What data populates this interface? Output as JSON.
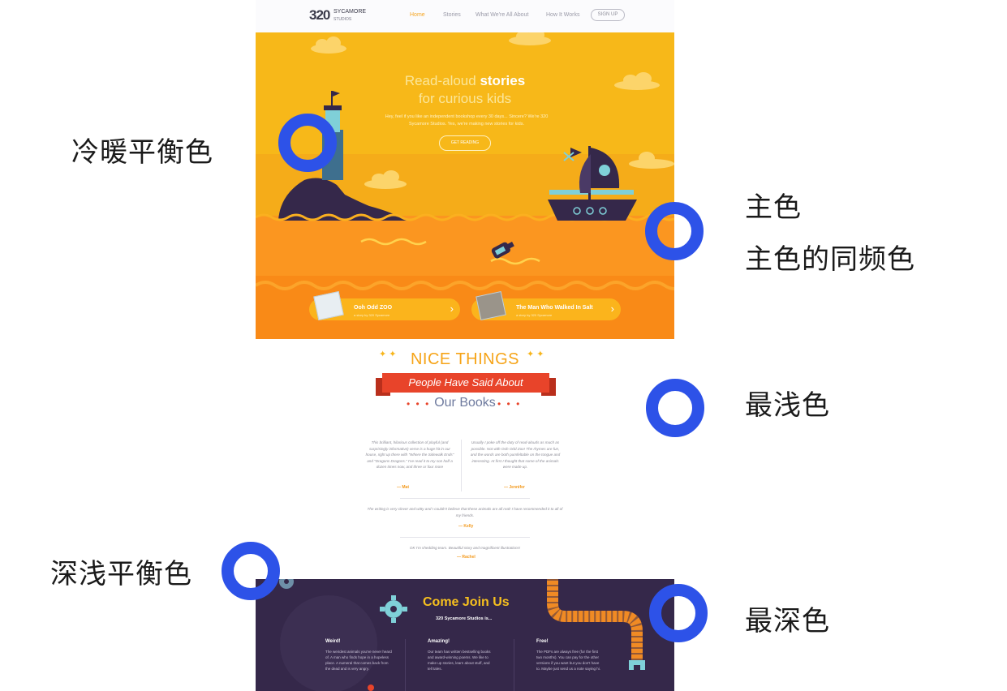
{
  "annotations": {
    "cool_warm_balance": "冷暖平衡色",
    "main_color": "主色",
    "main_color_same_frequency": "主色的同频色",
    "lightest_color": "最浅色",
    "dark_light_balance": "深浅平衡色",
    "darkest_color": "最深色"
  },
  "site": {
    "logo": {
      "number": "320",
      "name": "SYCAMORE",
      "sub": "STUDIOS"
    },
    "nav": {
      "links": [
        "Home",
        "Stories",
        "What We're All About",
        "How It Works"
      ],
      "active": "Home",
      "signup": "SIGN UP"
    },
    "hero": {
      "title_part1": "Read-aloud ",
      "title_bold": "stories",
      "title_line2": "for curious kids",
      "blurb": "Hey, feel if you like an independent bookshop every 30 days... Sincere? We're 320 Sycamore Studios. Yes, we're making new stories for kids.",
      "cta": "GET READING",
      "books": [
        {
          "title": "Ooh Odd ZOO",
          "sub": "a story by 320 Sycamore"
        },
        {
          "title": "The Man Who Walked In Salt",
          "sub": "a story by 320 Sycamore"
        }
      ]
    },
    "testimonials": {
      "heading1": "NICE THINGS",
      "ribbon": "People Have Said About",
      "heading2": "Our Books",
      "quotes": [
        {
          "text": "This brilliant, hilarious collection of playful (and surprisingly informative) verse is a huge hit in our house, right up there with \"Where the Sidewalk Ends\" and \"Dragons Dragons.\" I've read it to my son half a dozen times now, and three or four more",
          "author": "— Mat"
        },
        {
          "text": "Usually I poke off the duty of read-alouds as much as possible. Not with Ooh Odd Zoo! The rhymes are fun, and the words are both pumfeltable on the tongue and interesting. At first I thought that some of the animals were made up.",
          "author": "— Jennifer"
        },
        {
          "text": "The writing is very clever and witty and I couldn't believe that these animals are all real! I have recommended it to all of my friends.",
          "author": "— Kelly"
        },
        {
          "text": "OK I'm shedding tears. Beautiful story and magnificent illustrations!",
          "author": "— Rachel"
        }
      ]
    },
    "join": {
      "title": "Come Join Us",
      "subtitle": "320 Sycamore Studios is...",
      "columns": [
        {
          "heading": "Weird!",
          "text": "The weirdest animals you've never heard of. A man who finds hope in a hopeless place. A numeral that comes back from the dead and is very angry."
        },
        {
          "heading": "Amazing!",
          "text": "Our team has written bestselling books and award-winning poems. We like to make up stories, learn about stuff, and tell tales."
        },
        {
          "heading": "Free!",
          "text": "The PDFs are always free (for the first two months). You can pay for the other versions if you want but you don't have to. Maybe just send us a note saying hi."
        }
      ]
    }
  },
  "colors": {
    "ring": "#2d52e8",
    "hero_yellow": "#f7b819",
    "sea_orange": "#fb9620",
    "ribbon_red": "#e8442a",
    "deep_purple": "#35284a",
    "teal": "#7fd0d8"
  }
}
